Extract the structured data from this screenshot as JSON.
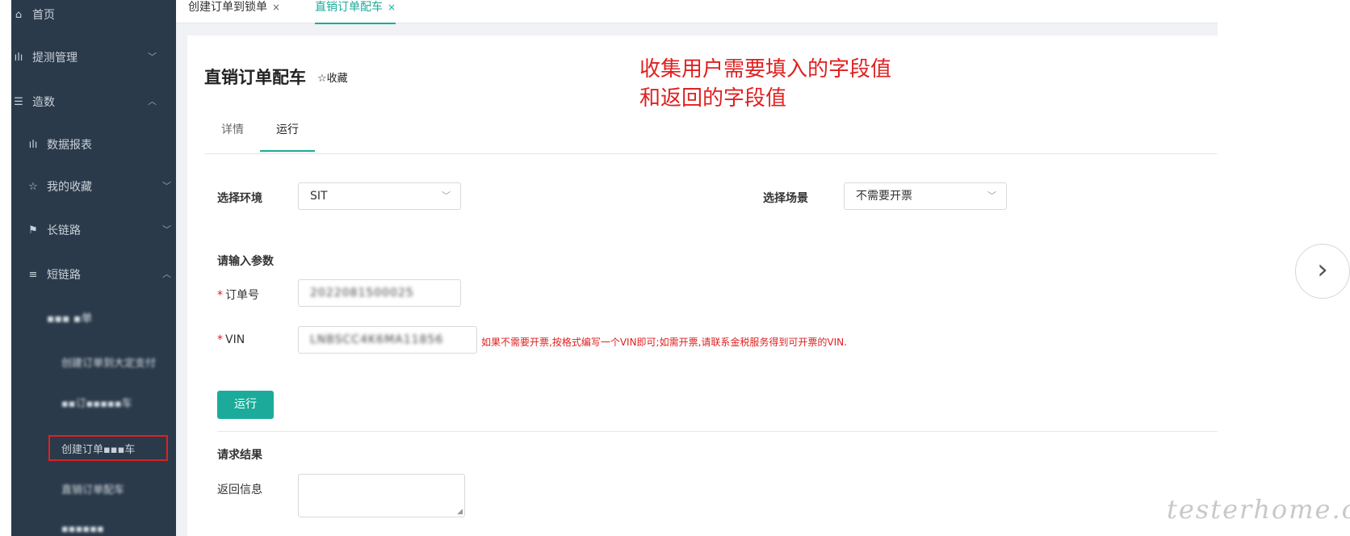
{
  "sidebar": {
    "items": [
      {
        "label": "首页",
        "icon": "home-icon"
      },
      {
        "label": "提测管理",
        "icon": "bar-chart-icon"
      },
      {
        "label": "造数",
        "icon": "data-icon"
      },
      {
        "label": "数据报表",
        "icon": "bar-chart-icon"
      },
      {
        "label": "我的收藏",
        "icon": "star-icon"
      },
      {
        "label": "长链路",
        "icon": "flag-icon"
      },
      {
        "label": "短链路",
        "icon": "menu-icon"
      },
      {
        "label": "▪▪▪ ▪单"
      },
      {
        "label": "创建订单到大定支付"
      },
      {
        "label": "▪▪订▪▪▪▪▪车"
      },
      {
        "label": "创建订单▪▪▪车"
      },
      {
        "label": "直销订单配车"
      },
      {
        "label": "▪▪▪▪▪▪"
      }
    ]
  },
  "tabs": [
    {
      "label": "创建订单到锁单",
      "close": "×"
    },
    {
      "label": "直销订单配车",
      "close": "×"
    }
  ],
  "page": {
    "title": "直销订单配车",
    "favorite": "☆收藏"
  },
  "annotation": {
    "line1": "收集用户需要填入的字段值",
    "line2": "和返回的字段值"
  },
  "subtabs": [
    "详情",
    "运行"
  ],
  "form": {
    "env_label": "选择环境",
    "env_value": "SIT",
    "scene_label": "选择场景",
    "scene_value": "不需要开票",
    "params_title": "请输入参数",
    "order_label": "订单号",
    "order_value": "2022081500025",
    "vin_label": "VIN",
    "vin_value": "LNBSCC4K6MA11856",
    "vin_hint": "如果不需要开票,按格式编写一个VIN即可;如需开票,请联系金税服务得到可开票的VIN.",
    "run_label": "运行",
    "result_title": "请求结果",
    "return_label": "返回信息"
  },
  "watermark": "testerhome.com",
  "colors": {
    "accent": "#1cab9a",
    "sidebar": "#2b3a4a",
    "annotation": "#e02020"
  }
}
